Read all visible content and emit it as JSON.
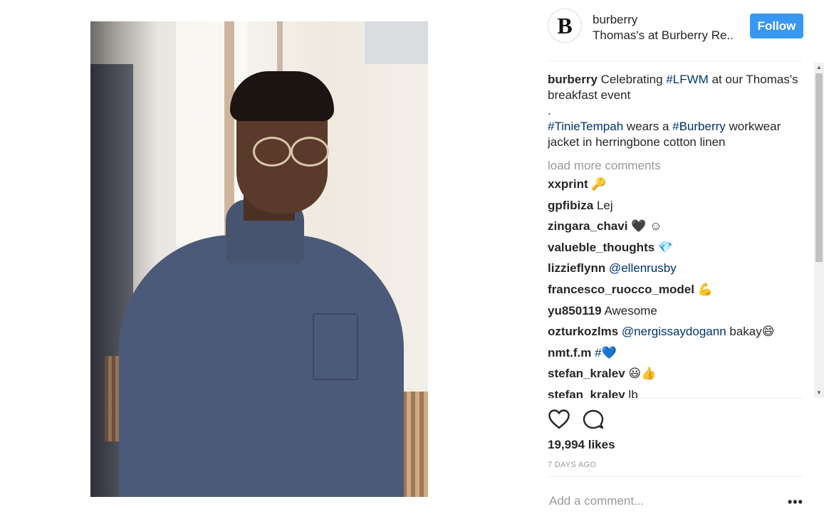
{
  "post": {
    "image_alt": "Man in glasses wearing a blue herringbone workwear jacket"
  },
  "header": {
    "avatar_letter": "B",
    "username": "burberry",
    "location": "Thomas's at Burberry Re..",
    "follow_label": "Follow"
  },
  "caption": {
    "username": "burberry",
    "text_1": " Celebrating ",
    "tag_1": "#LFWM",
    "text_2": " at our Thomas's breakfast event",
    "dot": ".",
    "tag_2": "#TinieTempah",
    "text_3": " wears a ",
    "tag_3": "#Burberry",
    "text_4": " workwear jacket in herringbone cotton linen"
  },
  "load_more": "load more comments",
  "comments": [
    {
      "user": "xxprint",
      "pre": " ",
      "mention": "",
      "text": "🔑"
    },
    {
      "user": "gpfibiza",
      "pre": " ",
      "mention": "",
      "text": "Lej"
    },
    {
      "user": "zingara_chavi",
      "pre": " ",
      "mention": "",
      "text": "🖤 ☺"
    },
    {
      "user": "valueble_thoughts",
      "pre": " ",
      "mention": "",
      "text": "💎"
    },
    {
      "user": "lizzieflynn",
      "pre": " ",
      "mention": "@ellenrusby",
      "text": ""
    },
    {
      "user": "francesco_ruocco_model",
      "pre": " ",
      "mention": "",
      "text": "💪"
    },
    {
      "user": "yu850119",
      "pre": " ",
      "mention": "",
      "text": "Awesome"
    },
    {
      "user": "ozturkozlms",
      "pre": " ",
      "mention": "@nergissaydogann",
      "text": " bakay😄"
    },
    {
      "user": "nmt.f.m",
      "pre": " ",
      "mention": "#💙",
      "text": ""
    },
    {
      "user": "stefan_kralev",
      "pre": " ",
      "mention": "",
      "text": "😃👍"
    },
    {
      "user": "stefan_kralev",
      "pre": " ",
      "mention": "",
      "text": "lb"
    }
  ],
  "likes": "19,994 likes",
  "posted_ago": "7 DAYS AGO",
  "add_comment_placeholder": "Add a comment...",
  "more_label": "•••",
  "icons": [
    "heart-icon",
    "comment-icon",
    "more-options-icon"
  ]
}
